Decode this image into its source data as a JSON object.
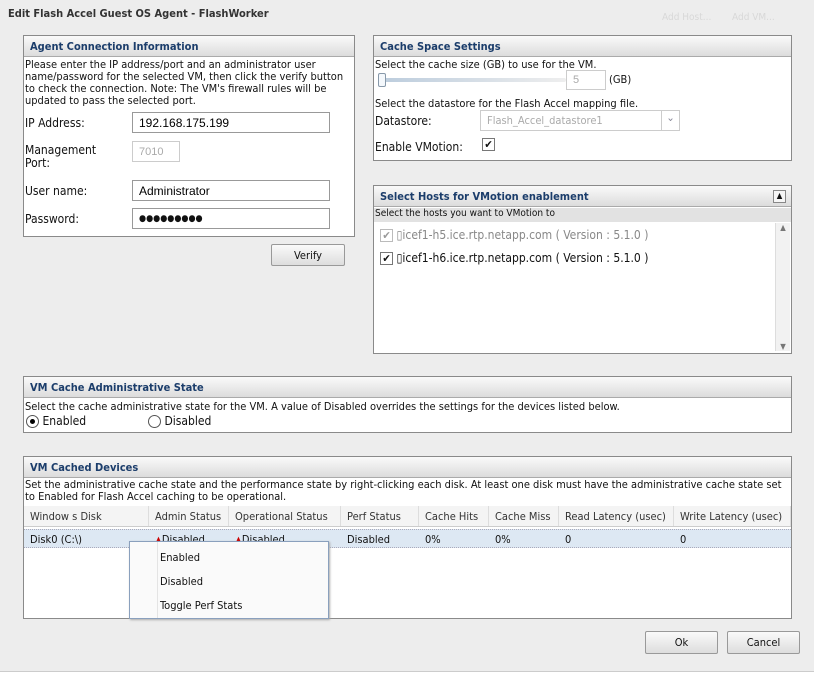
{
  "title": "Edit Flash Accel Guest OS Agent - FlashWorker",
  "background_links": [
    "Add Host...",
    "Add VM..."
  ],
  "agent": {
    "header": "Agent Connection Information",
    "desc": "Please enter the IP address/port and an administrator user name/password for the selected VM, then click the verify button to check the connection. Note: The VM's firewall rules will be updated to pass the selected port.",
    "ip_label": "IP Address:",
    "ip": "192.168.175.199",
    "port_label": "Management Port:",
    "port": "7010",
    "user_label": "User name:",
    "user": "Administrator",
    "pass_label": "Password:",
    "pass": "●●●●●●●●●",
    "verify": "Verify"
  },
  "cache": {
    "header": "Cache Space Settings",
    "size_desc": "Select the cache size (GB) to use for the VM.",
    "size": "5",
    "unit": "(GB)",
    "ds_desc": "Select the datastore for the Flash Accel mapping file.",
    "ds_label": "Datastore:",
    "ds": "Flash_Accel_datastore1",
    "vmotion_label": "Enable VMotion:",
    "vmotion_checked": true
  },
  "hosts": {
    "header": "Select Hosts for VMotion enablement",
    "sub": "Select the hosts you want to VMotion to",
    "items": [
      {
        "label": "icef1-h5.ice.rtp.netapp.com ( Version : 5.1.0 )",
        "checked": true,
        "disabled": true
      },
      {
        "label": "icef1-h6.ice.rtp.netapp.com ( Version : 5.1.0 )",
        "checked": true,
        "disabled": false
      }
    ]
  },
  "admin": {
    "header": "VM Cache Administrative State",
    "desc": "Select the cache administrative state for the VM. A value of Disabled overrides the settings for the devices listed below.",
    "enabled": "Enabled",
    "disabled": "Disabled",
    "selected": "Enabled"
  },
  "devices": {
    "header": "VM Cached Devices",
    "desc": "Set the administrative cache state and the performance state by right-clicking each disk. At least one disk must have the administrative cache state set to Enabled for Flash Accel caching to be operational.",
    "columns": [
      "Window s Disk",
      "Admin Status",
      "Operational Status",
      "Perf Status",
      "Cache Hits",
      "Cache Miss",
      "Read Latency (usec)",
      "Write Latency (usec)"
    ],
    "rows": [
      [
        "Disk0 (C:\\)",
        "Disabled",
        "Disabled",
        "Disabled",
        "0%",
        "0%",
        "0",
        "0"
      ]
    ]
  },
  "context_menu": [
    "Enabled",
    "Disabled",
    "Toggle Perf Stats"
  ],
  "buttons": {
    "ok": "Ok",
    "cancel": "Cancel"
  }
}
